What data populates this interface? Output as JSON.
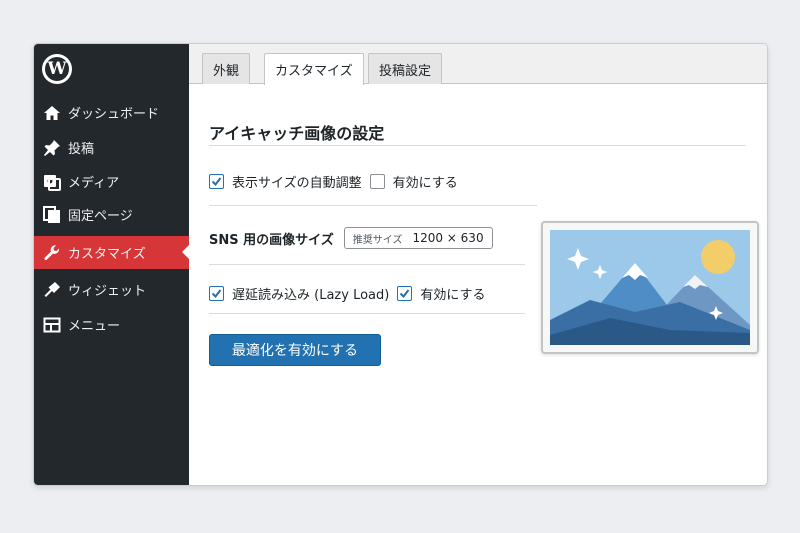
{
  "sidebar": {
    "items": [
      {
        "label": "ダッシュボード",
        "icon": "home-icon"
      },
      {
        "label": "投稿",
        "icon": "pin-icon"
      },
      {
        "label": "メディア",
        "icon": "media-icon"
      },
      {
        "label": "固定ページ",
        "icon": "pages-icon"
      },
      {
        "label": "カスタマイズ",
        "icon": "wrench-icon",
        "active": true
      },
      {
        "label": "ウィジェット",
        "icon": "widgets-icon"
      },
      {
        "label": "メニュー",
        "icon": "menu-icon"
      }
    ]
  },
  "tabs": [
    {
      "label": "外観"
    },
    {
      "label": "カスタマイズ",
      "active": true
    },
    {
      "label": "投稿設定"
    }
  ],
  "settings": {
    "title": "アイキャッチ画像の設定",
    "auto_resize": {
      "label": "表示サイズの自動調整",
      "checked": true,
      "enable_label": "有効にする",
      "enable_checked": false
    },
    "sns": {
      "label": "SNS 用の画像サイズ",
      "hint": "推奨サイズ",
      "value": "1200 × 630"
    },
    "lazy_load": {
      "label": "遅延読み込み (Lazy Load)",
      "checked": true,
      "enable_label": "有効にする",
      "enable_checked": true
    },
    "button_label": "最適化を有効にする"
  },
  "colors": {
    "sidebar_bg": "#23282d",
    "active": "#d63638",
    "primary": "#2271b1"
  }
}
